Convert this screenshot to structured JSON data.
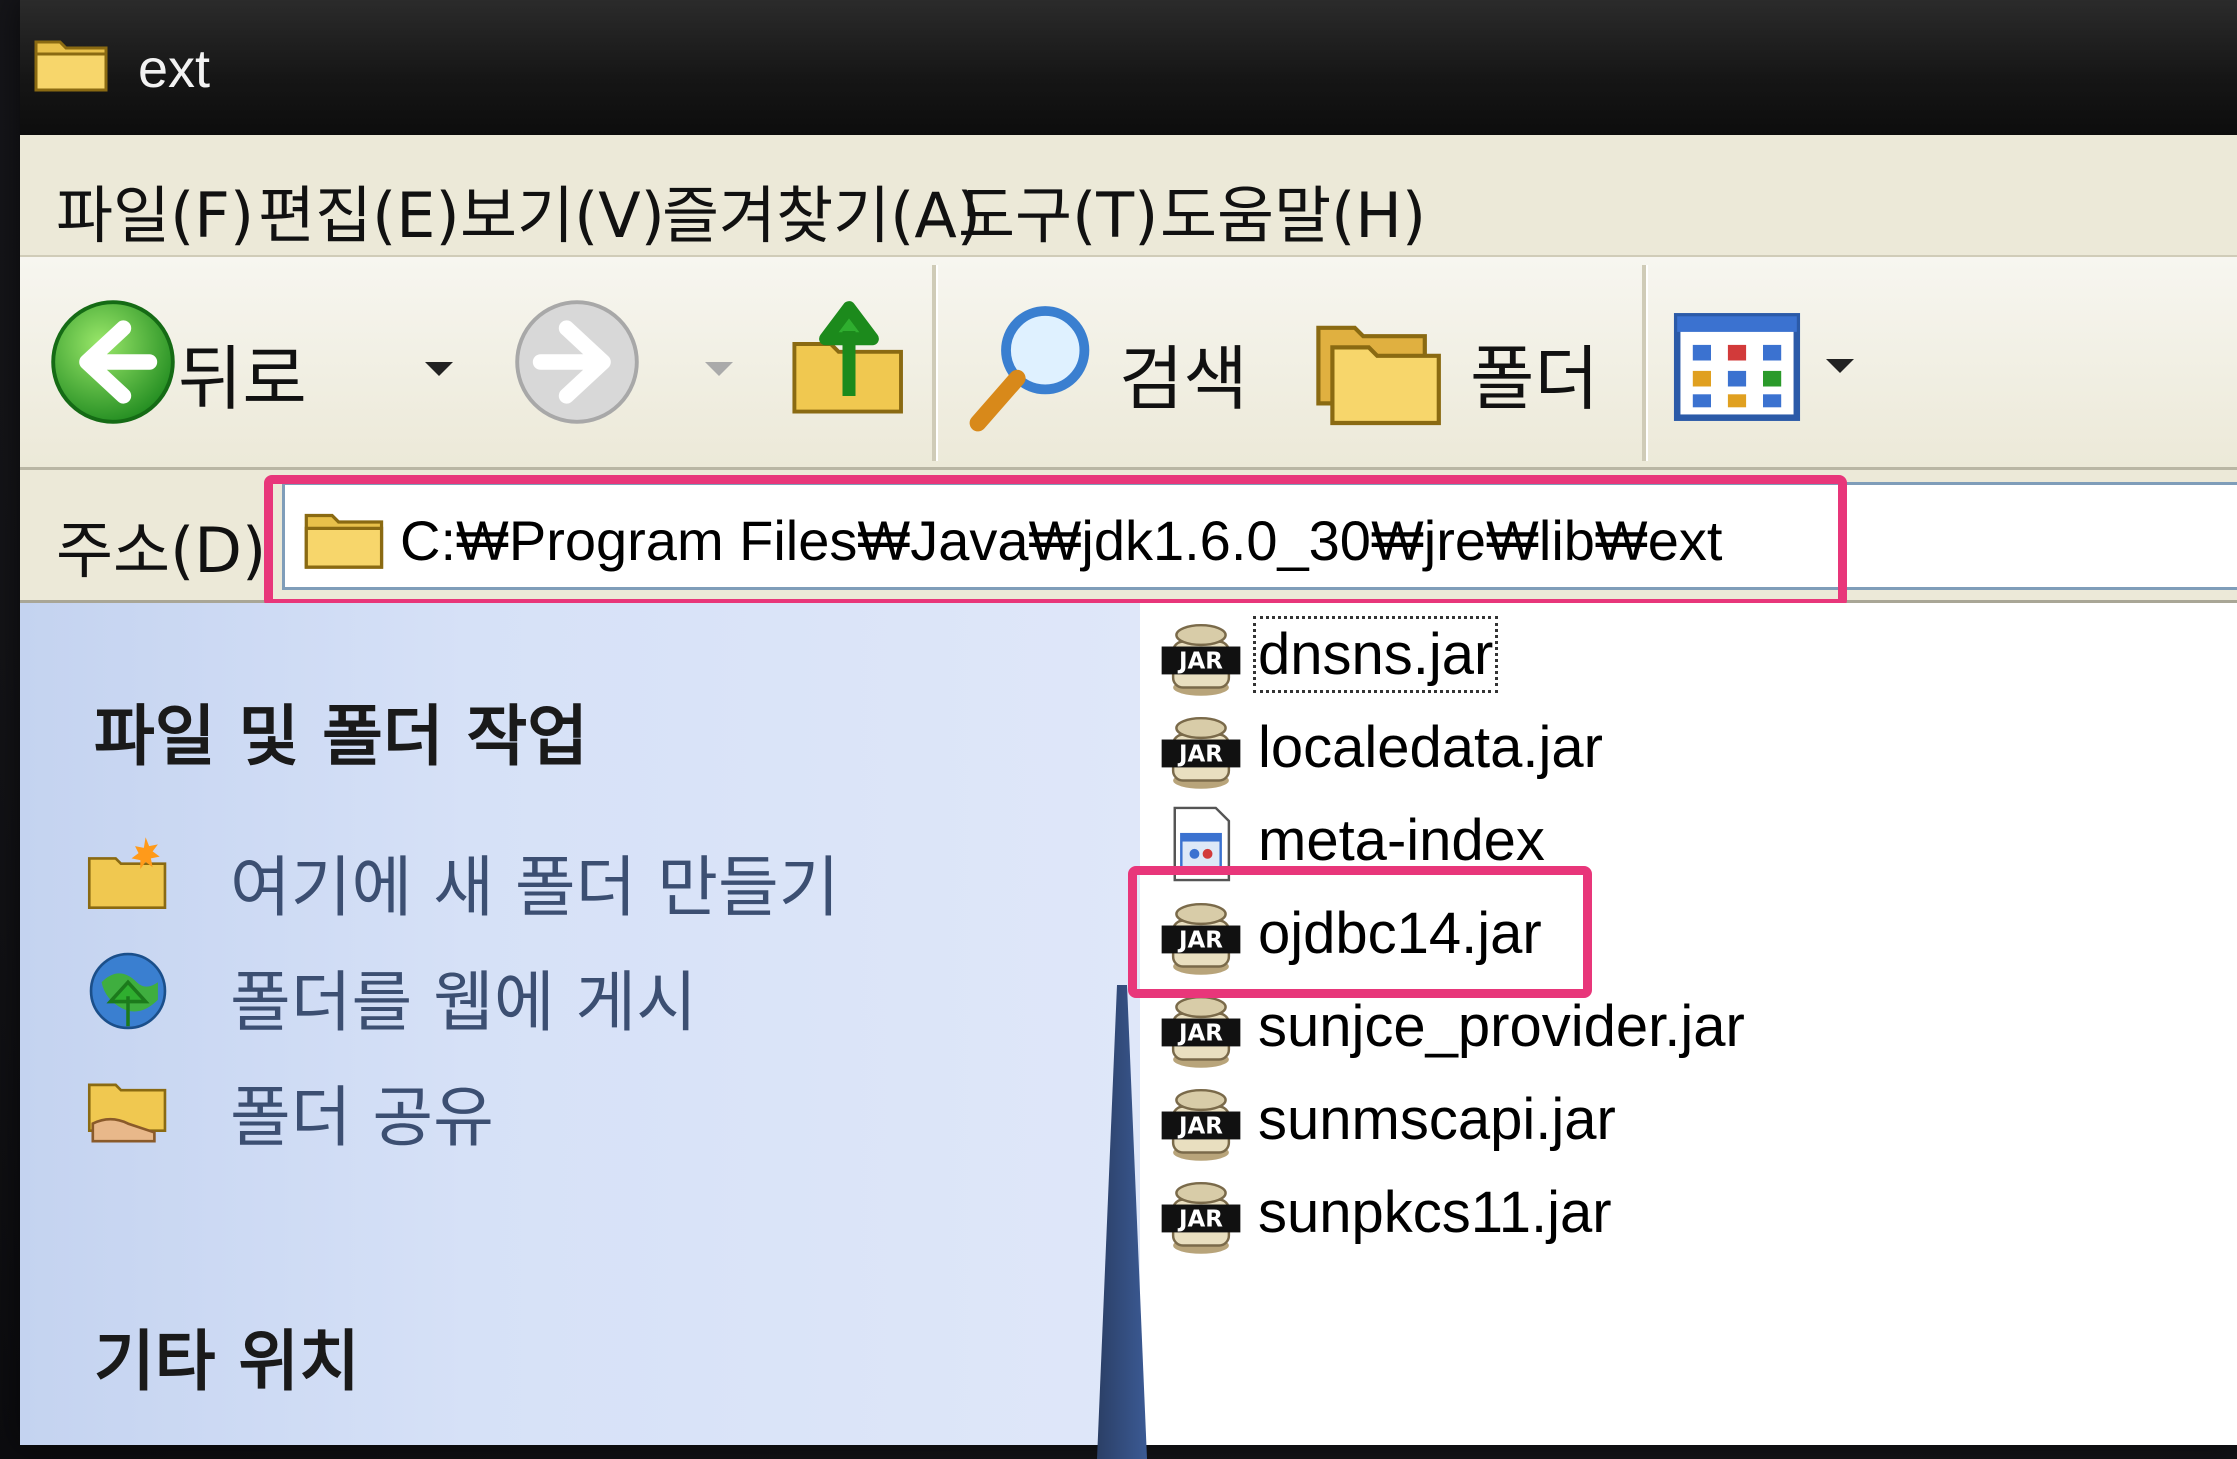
{
  "window": {
    "title": "ext"
  },
  "menu": {
    "items": [
      {
        "label": "파일(F)"
      },
      {
        "label": "편집(E)"
      },
      {
        "label": "보기(V)"
      },
      {
        "label": "즐겨찾기(A)"
      },
      {
        "label": "도구(T)"
      },
      {
        "label": "도움말(H)"
      }
    ]
  },
  "toolbar": {
    "back_label": "뒤로",
    "search_label": "검색",
    "folders_label": "폴더"
  },
  "address": {
    "label": "주소(D)",
    "path": "C:₩Program Files₩Java₩jdk1.6.0_30₩jre₩lib₩ext"
  },
  "taskpane": {
    "file_tasks_heading": "파일 및 폴더 작업",
    "tasks": [
      {
        "label": "여기에 새 폴더 만들기",
        "icon": "new-folder-icon"
      },
      {
        "label": "폴더를 웹에 게시",
        "icon": "publish-web-icon"
      },
      {
        "label": "폴더 공유",
        "icon": "share-folder-icon"
      }
    ],
    "other_places_heading": "기타 위치"
  },
  "files": [
    {
      "name": "dnsns.jar",
      "icon": "jar-icon"
    },
    {
      "name": "localedata.jar",
      "icon": "jar-icon"
    },
    {
      "name": "meta-index",
      "icon": "generic-file-icon"
    },
    {
      "name": "ojdbc14.jar",
      "icon": "jar-icon"
    },
    {
      "name": "sunjce_provider.jar",
      "icon": "jar-icon"
    },
    {
      "name": "sunmscapi.jar",
      "icon": "jar-icon"
    },
    {
      "name": "sunpkcs11.jar",
      "icon": "jar-icon"
    }
  ],
  "icon_badge_text": "JAR",
  "colors": {
    "highlight": "#e8367a",
    "taskpane": "#d6e1f7",
    "menubar": "#ece9d8",
    "titlebar": "#151515"
  }
}
